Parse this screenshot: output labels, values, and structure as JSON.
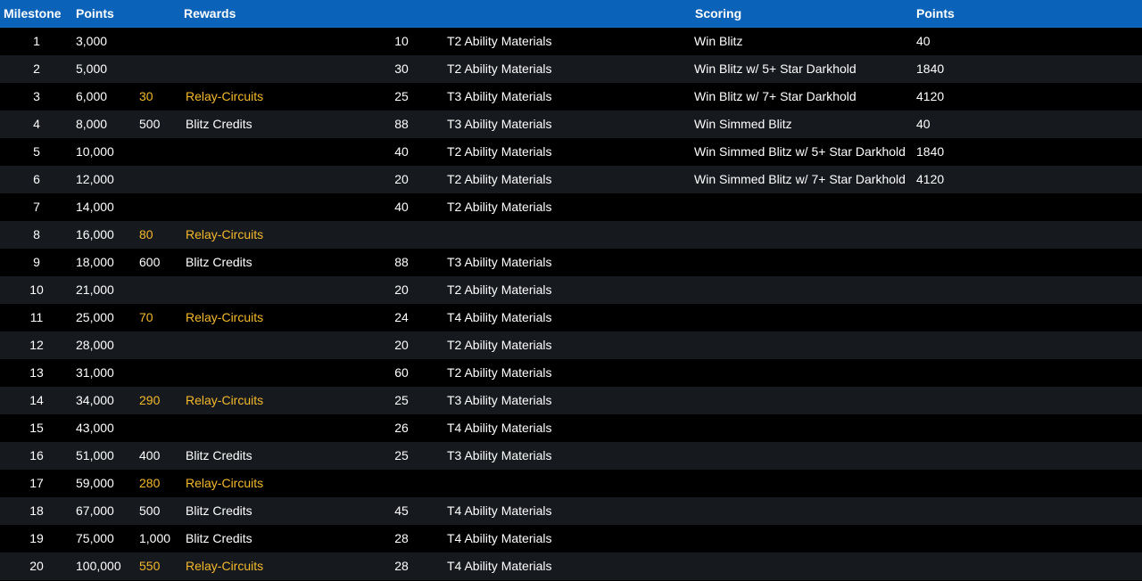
{
  "header": {
    "milestone": "Milestone",
    "points": "Points",
    "rewards": "Rewards",
    "scoring": "Scoring",
    "scoring_points": "Points"
  },
  "colors": {
    "header_bg": "#0b63b9",
    "row_even": "#000000",
    "row_odd": "#16191e",
    "relay_highlight": "#f5b92a"
  },
  "milestones": [
    {
      "milestone": "1",
      "points": "3,000",
      "reward1_qty": "",
      "reward1_name": "",
      "reward2_qty": "10",
      "reward2_name": "T2 Ability Materials"
    },
    {
      "milestone": "2",
      "points": "5,000",
      "reward1_qty": "",
      "reward1_name": "",
      "reward2_qty": "30",
      "reward2_name": "T2 Ability Materials"
    },
    {
      "milestone": "3",
      "points": "6,000",
      "reward1_qty": "30",
      "reward1_name": "Relay-Circuits",
      "reward2_qty": "25",
      "reward2_name": "T3 Ability Materials"
    },
    {
      "milestone": "4",
      "points": "8,000",
      "reward1_qty": "500",
      "reward1_name": "Blitz Credits",
      "reward2_qty": "88",
      "reward2_name": "T3 Ability Materials"
    },
    {
      "milestone": "5",
      "points": "10,000",
      "reward1_qty": "",
      "reward1_name": "",
      "reward2_qty": "40",
      "reward2_name": "T2 Ability Materials"
    },
    {
      "milestone": "6",
      "points": "12,000",
      "reward1_qty": "",
      "reward1_name": "",
      "reward2_qty": "20",
      "reward2_name": "T2 Ability Materials"
    },
    {
      "milestone": "7",
      "points": "14,000",
      "reward1_qty": "",
      "reward1_name": "",
      "reward2_qty": "40",
      "reward2_name": "T2 Ability Materials"
    },
    {
      "milestone": "8",
      "points": "16,000",
      "reward1_qty": "80",
      "reward1_name": "Relay-Circuits",
      "reward2_qty": "",
      "reward2_name": ""
    },
    {
      "milestone": "9",
      "points": "18,000",
      "reward1_qty": "600",
      "reward1_name": "Blitz Credits",
      "reward2_qty": "88",
      "reward2_name": "T3 Ability Materials"
    },
    {
      "milestone": "10",
      "points": "21,000",
      "reward1_qty": "",
      "reward1_name": "",
      "reward2_qty": "20",
      "reward2_name": "T2 Ability Materials"
    },
    {
      "milestone": "11",
      "points": "25,000",
      "reward1_qty": "70",
      "reward1_name": "Relay-Circuits",
      "reward2_qty": "24",
      "reward2_name": "T4 Ability Materials"
    },
    {
      "milestone": "12",
      "points": "28,000",
      "reward1_qty": "",
      "reward1_name": "",
      "reward2_qty": "20",
      "reward2_name": "T2 Ability Materials"
    },
    {
      "milestone": "13",
      "points": "31,000",
      "reward1_qty": "",
      "reward1_name": "",
      "reward2_qty": "60",
      "reward2_name": "T2 Ability Materials"
    },
    {
      "milestone": "14",
      "points": "34,000",
      "reward1_qty": "290",
      "reward1_name": "Relay-Circuits",
      "reward2_qty": "25",
      "reward2_name": "T3 Ability Materials"
    },
    {
      "milestone": "15",
      "points": "43,000",
      "reward1_qty": "",
      "reward1_name": "",
      "reward2_qty": "26",
      "reward2_name": "T4 Ability Materials"
    },
    {
      "milestone": "16",
      "points": "51,000",
      "reward1_qty": "400",
      "reward1_name": "Blitz Credits",
      "reward2_qty": "25",
      "reward2_name": "T3 Ability Materials"
    },
    {
      "milestone": "17",
      "points": "59,000",
      "reward1_qty": "280",
      "reward1_name": "Relay-Circuits",
      "reward2_qty": "",
      "reward2_name": ""
    },
    {
      "milestone": "18",
      "points": "67,000",
      "reward1_qty": "500",
      "reward1_name": "Blitz Credits",
      "reward2_qty": "45",
      "reward2_name": "T4 Ability Materials"
    },
    {
      "milestone": "19",
      "points": "75,000",
      "reward1_qty": "1,000",
      "reward1_name": "Blitz Credits",
      "reward2_qty": "28",
      "reward2_name": "T4 Ability Materials"
    },
    {
      "milestone": "20",
      "points": "100,000",
      "reward1_qty": "550",
      "reward1_name": "Relay-Circuits",
      "reward2_qty": "28",
      "reward2_name": "T4 Ability Materials"
    }
  ],
  "scoring": [
    {
      "label": "Win Blitz",
      "points": "40"
    },
    {
      "label": "Win Blitz w/ 5+ Star Darkhold",
      "points": "1840"
    },
    {
      "label": "Win Blitz w/ 7+ Star Darkhold",
      "points": "4120"
    },
    {
      "label": "Win Simmed Blitz",
      "points": "40"
    },
    {
      "label": "Win Simmed Blitz w/ 5+ Star Darkhold",
      "points": "1840"
    },
    {
      "label": "Win Simmed Blitz w/ 7+ Star Darkhold",
      "points": "4120"
    }
  ]
}
